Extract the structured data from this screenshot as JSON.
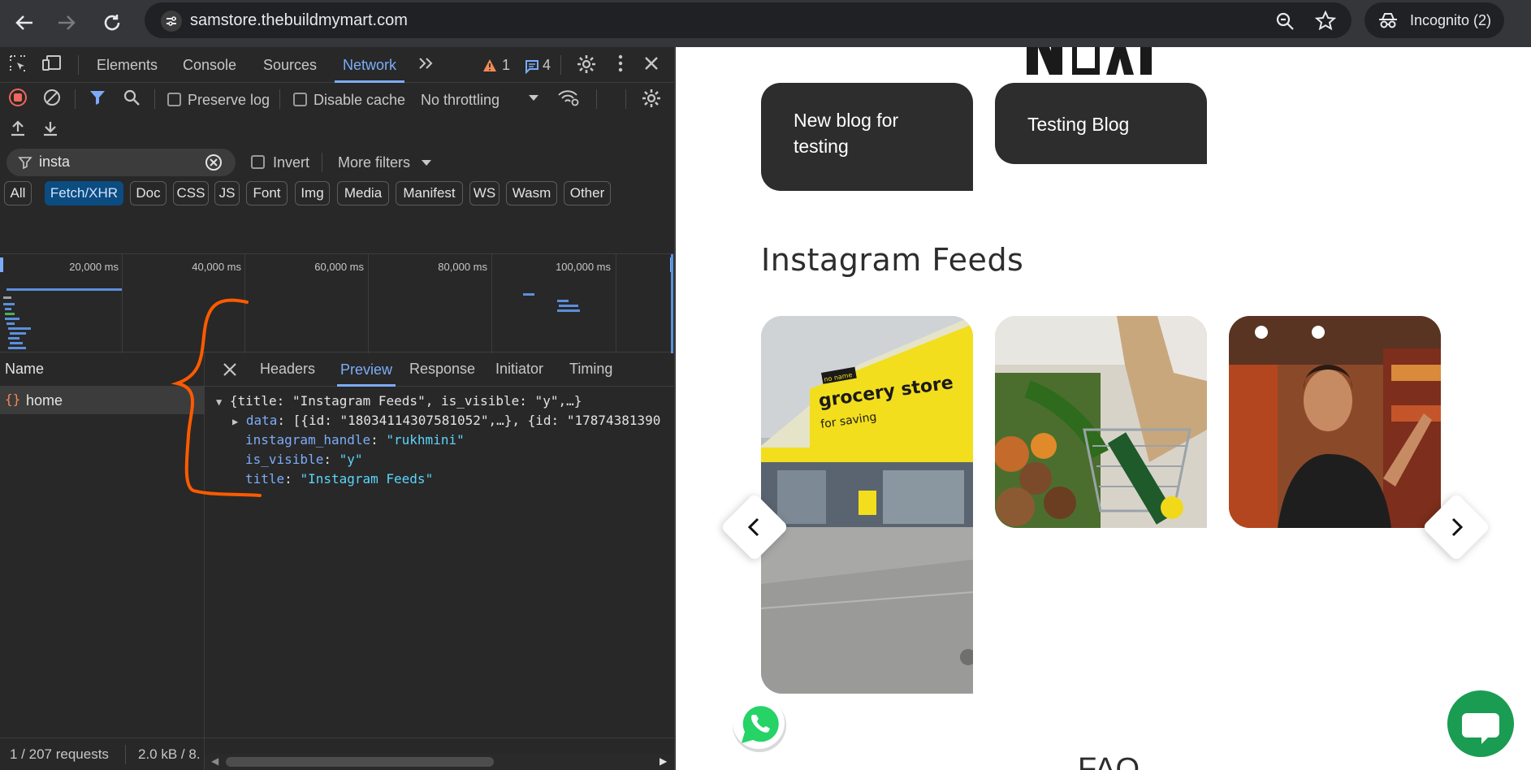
{
  "browser": {
    "url": "samstore.thebuildmymart.com",
    "incognito_label": "Incognito (2)"
  },
  "devtools": {
    "tabs": [
      "Elements",
      "Console",
      "Sources",
      "Network"
    ],
    "active_tab": "Network",
    "warnings_count": "1",
    "messages_count": "4",
    "preserve_log": "Preserve log",
    "disable_cache": "Disable cache",
    "throttling": "No throttling",
    "filter_value": "insta",
    "invert": "Invert",
    "more_filters": "More filters",
    "type_filters": [
      "All",
      "Fetch/XHR",
      "Doc",
      "CSS",
      "JS",
      "Font",
      "Img",
      "Media",
      "Manifest",
      "WS",
      "Wasm",
      "Other"
    ],
    "active_type_filter": "Fetch/XHR",
    "timeline_labels": [
      "20,000 ms",
      "40,000 ms",
      "60,000 ms",
      "80,000 ms",
      "100,000 ms"
    ],
    "name_header": "Name",
    "request_name": "home",
    "detail_tabs": [
      "Headers",
      "Preview",
      "Response",
      "Initiator",
      "Timing"
    ],
    "active_detail_tab": "Preview",
    "preview": {
      "summary": "{title: \"Instagram Feeds\", is_visible: \"y\",…}",
      "data_key": "data",
      "data_value": "[{id: \"18034114307581052\",…}, {id: \"17874381390",
      "handle_key": "instagram_handle",
      "handle_value": "\"rukhmini\"",
      "visible_key": "is_visible",
      "visible_value": "\"y\"",
      "title_key": "title",
      "title_value": "\"Instagram Feeds\""
    },
    "status_requests": "1 / 207 requests",
    "status_size": "2.0 kB / 8."
  },
  "site": {
    "blog_cards": [
      "New blog for testing",
      "Testing Blog"
    ],
    "section_title": "Instagram Feeds",
    "instagram_images": [
      "grocery-store-front",
      "vegetables-basket",
      "woman-in-aisle"
    ],
    "store_sign_line1": "grocery store",
    "store_sign_line2": "for saving",
    "store_sign_badge": "no name",
    "faq_partial": "FAQ"
  },
  "colors": {
    "accent_blue": "#7cacf8",
    "dark_card": "#2d2d2d",
    "whatsapp_green": "#25d366",
    "chat_green": "#1a9c52",
    "annotation_orange": "#ff5a00"
  }
}
